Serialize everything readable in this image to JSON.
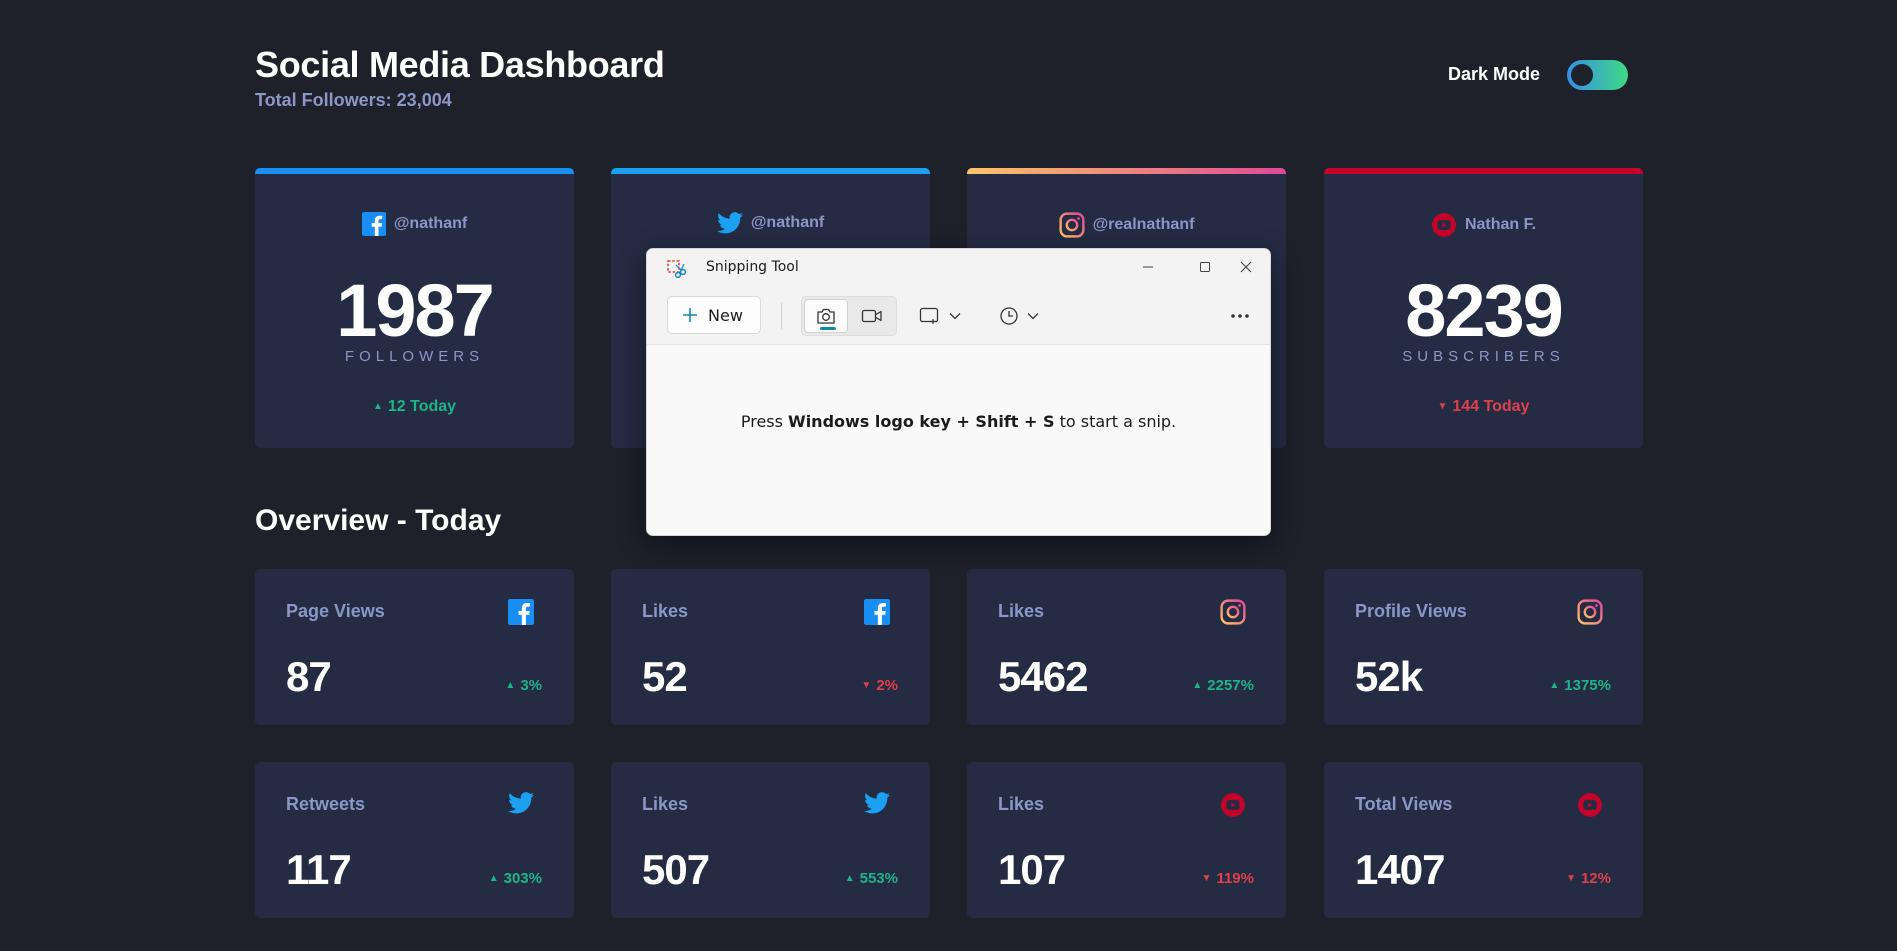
{
  "header": {
    "title": "Social Media Dashboard",
    "total_followers": "Total Followers: 23,004",
    "dark_mode_label": "Dark Mode",
    "dark_mode_on": true
  },
  "colors": {
    "background": "#1e202a",
    "card": "#252b43",
    "muted_text": "#8b97c6",
    "up": "#1db489",
    "down": "#dc414c",
    "facebook": "#198ff5",
    "twitter": "#1ca0f2",
    "instagram_start": "#fdc468",
    "instagram_end": "#df4996",
    "youtube": "#c4032a",
    "toggle_start": "#378fe6",
    "toggle_end": "#3eda82"
  },
  "follower_cards": [
    {
      "platform": "facebook",
      "icon": "facebook-icon",
      "handle": "@nathanf",
      "count": "1987",
      "unit": "FOLLOWERS",
      "today": "12 Today",
      "trend": "up"
    },
    {
      "platform": "twitter",
      "icon": "twitter-icon",
      "handle": "@nathanf",
      "trend": "up"
    },
    {
      "platform": "instagram",
      "icon": "instagram-icon",
      "handle": "@realnathanf",
      "trend": "up"
    },
    {
      "platform": "youtube",
      "icon": "youtube-icon",
      "handle": "Nathan F.",
      "count": "8239",
      "unit": "SUBSCRIBERS",
      "today": "144 Today",
      "trend": "down"
    }
  ],
  "overview": {
    "title": "Overview - Today",
    "cards": [
      {
        "label": "Page Views",
        "icon": "facebook-icon",
        "value": "87",
        "change": "3%",
        "trend": "up"
      },
      {
        "label": "Likes",
        "icon": "facebook-icon",
        "value": "52",
        "change": "2%",
        "trend": "down"
      },
      {
        "label": "Likes",
        "icon": "instagram-icon",
        "value": "5462",
        "change": "2257%",
        "trend": "up"
      },
      {
        "label": "Profile Views",
        "icon": "instagram-icon",
        "value": "52k",
        "change": "1375%",
        "trend": "up"
      },
      {
        "label": "Retweets",
        "icon": "twitter-icon",
        "value": "117",
        "change": "303%",
        "trend": "up"
      },
      {
        "label": "Likes",
        "icon": "twitter-icon",
        "value": "507",
        "change": "553%",
        "trend": "up"
      },
      {
        "label": "Likes",
        "icon": "youtube-icon",
        "value": "107",
        "change": "119%",
        "trend": "down"
      },
      {
        "label": "Total Views",
        "icon": "youtube-icon",
        "value": "1407",
        "change": "12%",
        "trend": "down"
      }
    ]
  },
  "snipping_tool": {
    "title": "Snipping Tool",
    "new_label": "New",
    "message_prefix": "Press ",
    "message_keys": "Windows logo key + Shift + S",
    "message_suffix": " to start a snip."
  }
}
